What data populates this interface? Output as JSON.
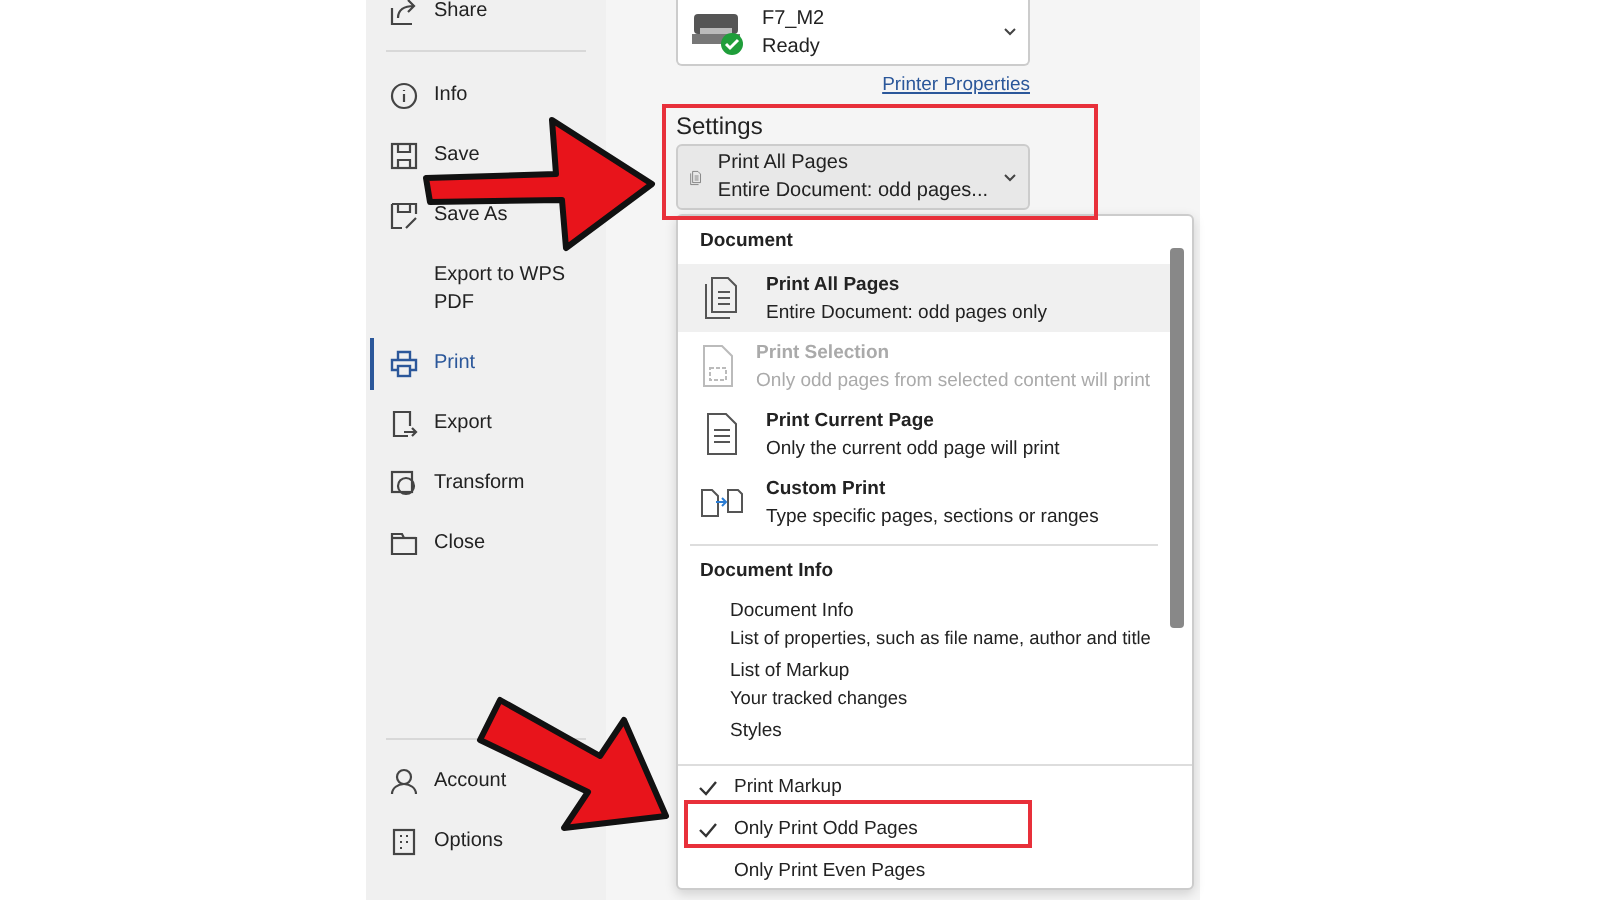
{
  "sidebar": {
    "items": [
      {
        "label": "Share",
        "selected": false
      },
      {
        "label": "Info",
        "selected": false
      },
      {
        "label": "Save",
        "selected": false
      },
      {
        "label": "Save As",
        "selected": false
      },
      {
        "label": "Export to WPS PDF",
        "selected": false
      },
      {
        "label": "Print",
        "selected": true
      },
      {
        "label": "Export",
        "selected": false
      },
      {
        "label": "Transform",
        "selected": false
      },
      {
        "label": "Close",
        "selected": false
      }
    ],
    "bottom_items": [
      {
        "label": "Account",
        "selected": false
      },
      {
        "label": "Options",
        "selected": false
      }
    ]
  },
  "printer": {
    "name": "F7_M2",
    "status": "Ready",
    "properties_link": "Printer Properties"
  },
  "settings": {
    "heading": "Settings",
    "title": "Print All Pages",
    "subtitle": "Entire Document: odd pages..."
  },
  "menu": {
    "sections": [
      {
        "heading": "Document",
        "items": [
          {
            "title": "Print All Pages",
            "subtitle": "Entire Document: odd pages only",
            "selected": true,
            "disabled": false
          },
          {
            "title": "Print Selection",
            "subtitle": "Only odd pages from selected content will print",
            "selected": false,
            "disabled": true
          },
          {
            "title": "Print Current Page",
            "subtitle": "Only the current odd page will print",
            "selected": false,
            "disabled": false
          },
          {
            "title": "Custom Print",
            "subtitle": "Type specific pages, sections or ranges",
            "selected": false,
            "disabled": false
          }
        ]
      },
      {
        "heading": "Document Info",
        "items": [
          {
            "title": "Document Info",
            "subtitle": "List of properties, such as file name, author and title",
            "selected": false,
            "disabled": false
          },
          {
            "title": "List of Markup",
            "subtitle": "Your tracked changes",
            "selected": false,
            "disabled": false
          },
          {
            "title": "Styles",
            "selected": false,
            "disabled": false
          }
        ]
      }
    ],
    "options": [
      {
        "label": "Print Markup",
        "checked": true
      },
      {
        "label": "Only Print Odd Pages",
        "checked": true
      },
      {
        "label": "Only Print Even Pages",
        "checked": false
      }
    ]
  }
}
